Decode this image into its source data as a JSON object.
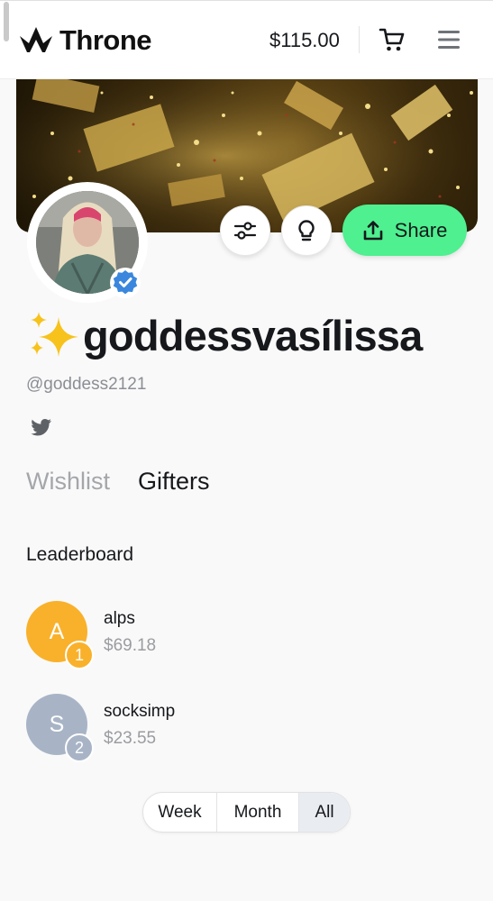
{
  "header": {
    "brand": "Throne",
    "balance": "$115.00"
  },
  "profile": {
    "display_name": "goddessvasílissa",
    "handle": "@goddess2121",
    "verified": true
  },
  "actions": {
    "share_label": "Share"
  },
  "tabs": [
    {
      "label": "Wishlist",
      "active": false
    },
    {
      "label": "Gifters",
      "active": true
    }
  ],
  "leaderboard": {
    "title": "Leaderboard",
    "entries": [
      {
        "initial": "A",
        "name": "alps",
        "amount": "$69.18",
        "rank": "1",
        "color": "#f9b12b"
      },
      {
        "initial": "S",
        "name": "socksimp",
        "amount": "$23.55",
        "rank": "2",
        "color": "#a8b4c6"
      }
    ]
  },
  "period": {
    "options": [
      "Week",
      "Month",
      "All"
    ],
    "selected": "All"
  },
  "colors": {
    "share_accent": "#4ef08f",
    "verified_blue": "#3a87dd"
  },
  "icons": [
    "throne-logo-icon",
    "cart-icon",
    "menu-icon",
    "sliders-icon",
    "lightbulb-icon",
    "share-upload-icon",
    "verified-badge-icon",
    "sparkles-icon",
    "twitter-icon"
  ]
}
